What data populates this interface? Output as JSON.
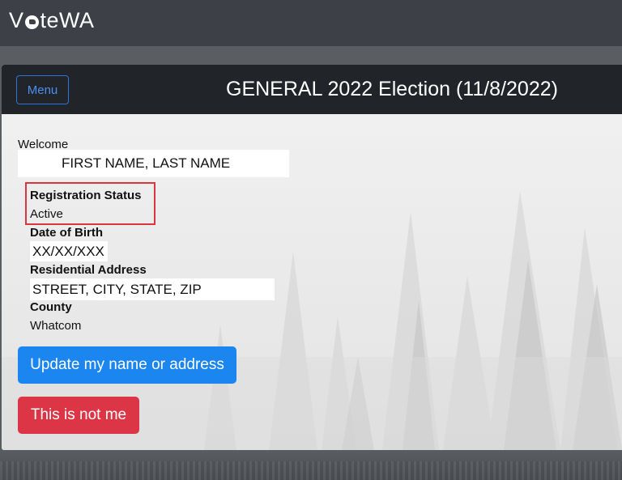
{
  "app": {
    "logo_prefix": "V",
    "logo_suffix": "teWA",
    "logo_icon": "ballot-circle-icon"
  },
  "header": {
    "menu_label": "Menu",
    "election_title": "GENERAL 2022 Election (11/8/2022)"
  },
  "voter": {
    "welcome_label": "Welcome",
    "name": "FIRST NAME, LAST NAME",
    "registration_status_label": "Registration Status",
    "registration_status": "Active",
    "dob_label": "Date of Birth",
    "dob": "XX/XX/XXX",
    "address_label": "Residential Address",
    "address": "STREET, CITY, STATE, ZIP",
    "county_label": "County",
    "county": "Whatcom"
  },
  "actions": {
    "update_label": "Update my name or address",
    "not_me_label": "This is not me"
  },
  "colors": {
    "header_bg": "#212529",
    "primary": "#1b85f0",
    "danger": "#dc3545",
    "highlight_border": "#d9363e"
  }
}
